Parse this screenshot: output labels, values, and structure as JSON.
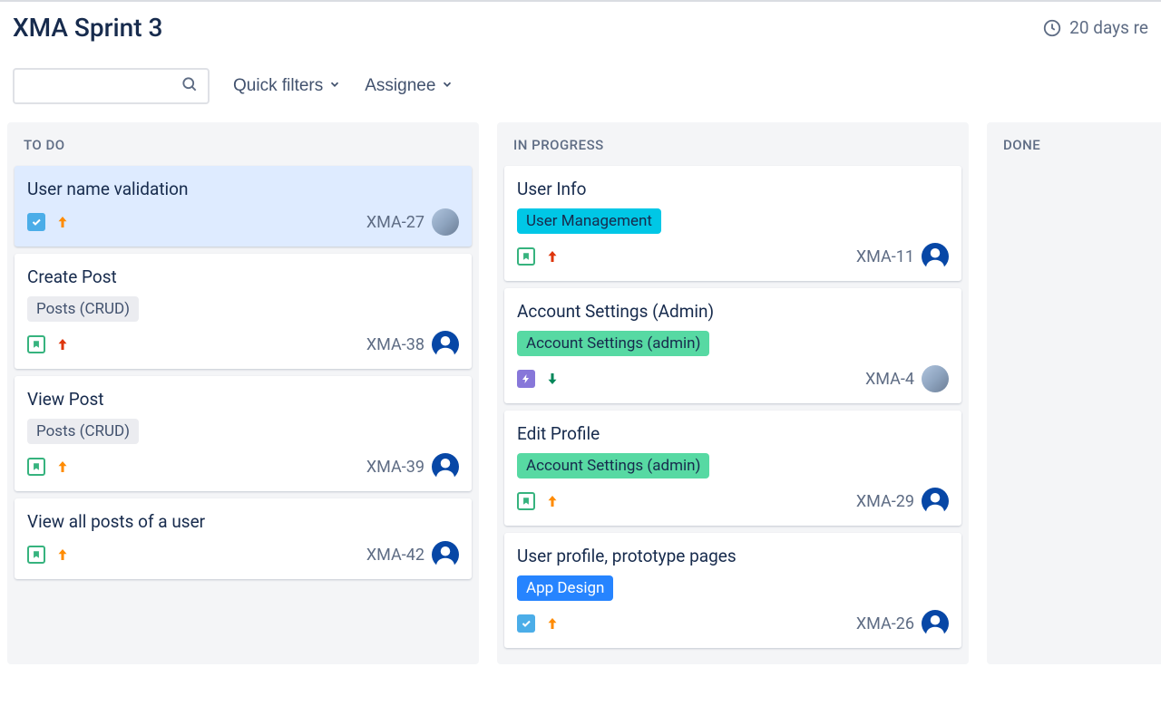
{
  "sprint": {
    "title": "XMA Sprint 3",
    "remaining": "20 days re"
  },
  "toolbar": {
    "quick_filters": "Quick filters",
    "assignee": "Assignee"
  },
  "columns": [
    {
      "id": "todo",
      "label": "TO DO",
      "cards": [
        {
          "title": "User name validation",
          "key": "XMA-27",
          "type": "task",
          "priority": "up-orange",
          "avatar": "photo",
          "selected": true
        },
        {
          "title": "Create Post",
          "epic": "Posts (CRUD)",
          "epicColor": "grey",
          "key": "XMA-38",
          "type": "story",
          "priority": "up-red",
          "avatar": "default"
        },
        {
          "title": "View Post",
          "epic": "Posts (CRUD)",
          "epicColor": "grey",
          "key": "XMA-39",
          "type": "story",
          "priority": "up-orange",
          "avatar": "default"
        },
        {
          "title": "View all posts of a user",
          "key": "XMA-42",
          "type": "story",
          "priority": "up-orange",
          "avatar": "default"
        }
      ]
    },
    {
      "id": "inprogress",
      "label": "IN PROGRESS",
      "cards": [
        {
          "title": "User Info",
          "epic": "User Management",
          "epicColor": "cyan",
          "key": "XMA-11",
          "type": "story",
          "priority": "up-red",
          "avatar": "default"
        },
        {
          "title": "Account Settings (Admin)",
          "epic": "Account Settings (admin)",
          "epicColor": "green",
          "key": "XMA-4",
          "type": "epic",
          "priority": "down-green",
          "avatar": "photo"
        },
        {
          "title": "Edit Profile",
          "epic": "Account Settings (admin)",
          "epicColor": "green",
          "key": "XMA-29",
          "type": "story",
          "priority": "up-orange",
          "avatar": "default"
        },
        {
          "title": "User profile, prototype pages",
          "epic": "App Design",
          "epicColor": "blue",
          "key": "XMA-26",
          "type": "task",
          "priority": "up-orange",
          "avatar": "default"
        }
      ]
    },
    {
      "id": "done",
      "label": "DONE",
      "cards": []
    }
  ],
  "icons": {
    "priority": {
      "up-orange": "#FF8B00",
      "up-red": "#DE350B",
      "down-green": "#00875A"
    }
  }
}
